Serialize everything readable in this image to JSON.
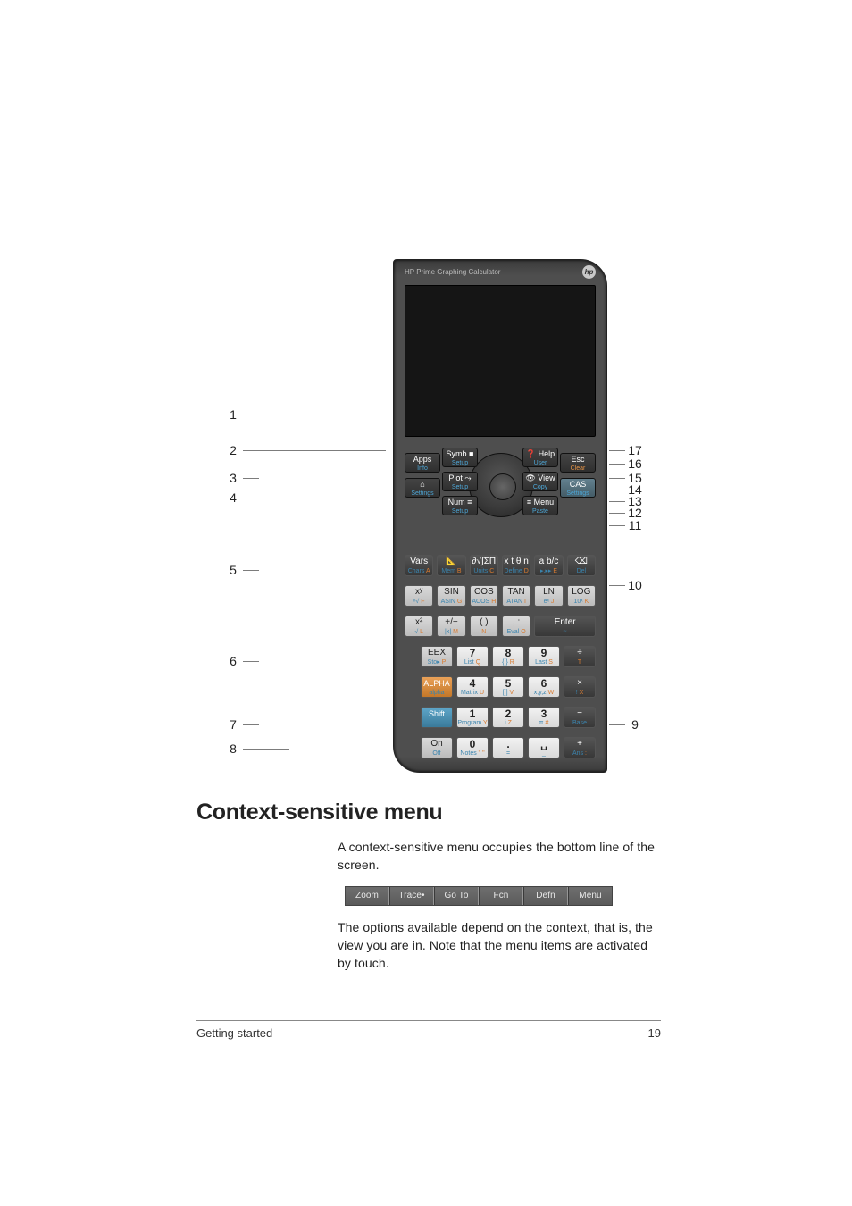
{
  "figure": {
    "brand": "HP Prime Graphing Calculator",
    "logo": "hp",
    "nav": {
      "apps": {
        "main": "Apps",
        "sub": "Info"
      },
      "symb": {
        "main": "Symb ■",
        "sub": "Setup"
      },
      "help": {
        "main": "❓ Help",
        "sub": "User"
      },
      "esc": {
        "main": "Esc",
        "sub": "Clear"
      },
      "home": {
        "main": "⌂",
        "sub": "Settings"
      },
      "plot": {
        "main": "Plot ⤳",
        "sub": "Setup"
      },
      "view": {
        "main": "👁 View",
        "sub": "Copy"
      },
      "cas": {
        "main": "CAS",
        "sub": "Settings"
      },
      "num": {
        "main": "Num ≡",
        "sub": "Setup"
      },
      "menu": {
        "main": "≡ Menu",
        "sub": "Paste"
      }
    },
    "rows": [
      [
        {
          "top": "Vars",
          "bot": "Chars",
          "br": "A",
          "cls": "dark"
        },
        {
          "top": "📐",
          "bot": "Mem",
          "br": "B",
          "cls": "dark"
        },
        {
          "top": "∂√∫ΣΠ",
          "bot": "Units",
          "br": "C",
          "cls": "dark"
        },
        {
          "top": "x t θ n",
          "bot": "Define",
          "br": "D",
          "cls": "dark"
        },
        {
          "top": "a b/c",
          "bot": "▸.▸▸",
          "br": "E",
          "cls": "dark"
        },
        {
          "top": "⌫",
          "bot": "Del",
          "br": "",
          "cls": "dark"
        }
      ],
      [
        {
          "top": "xʸ",
          "bot": "ⁿ√",
          "br": "F"
        },
        {
          "top": "SIN",
          "bot": "ASIN",
          "br": "G"
        },
        {
          "top": "COS",
          "bot": "ACOS",
          "br": "H"
        },
        {
          "top": "TAN",
          "bot": "ATAN",
          "br": "I"
        },
        {
          "top": "LN",
          "bot": "eˣ",
          "br": "J"
        },
        {
          "top": "LOG",
          "bot": "10ˣ",
          "br": "K"
        }
      ],
      [
        {
          "top": "x²",
          "bot": "√",
          "br": "L"
        },
        {
          "top": "+/−",
          "bot": "|x|",
          "br": "M"
        },
        {
          "top": "( )",
          "bot": "",
          "br": "N"
        },
        {
          "top": ", :",
          "bot": "Eval",
          "br": "O"
        },
        {
          "top": "Enter",
          "bot": "≈",
          "br": "",
          "cls": "dark enter"
        }
      ],
      [
        {
          "top": "EEX",
          "bot": "Sto▸",
          "br": "P"
        },
        {
          "top": "7",
          "bot": "List",
          "br": "Q",
          "cls": "num"
        },
        {
          "top": "8",
          "bot": "{ }",
          "br": "R",
          "cls": "num"
        },
        {
          "top": "9",
          "bot": "Last",
          "br": "S",
          "cls": "num"
        },
        {
          "top": "÷",
          "bot": "",
          "br": "T",
          "cls": "dark"
        }
      ],
      [
        {
          "top": "ALPHA",
          "bot": "alpha",
          "br": "",
          "cls": "alpha"
        },
        {
          "top": "4",
          "bot": "Matrix",
          "br": "U",
          "cls": "num"
        },
        {
          "top": "5",
          "bot": "[ ]",
          "br": "V",
          "cls": "num"
        },
        {
          "top": "6",
          "bot": "x,y,z",
          "br": "W",
          "cls": "num"
        },
        {
          "top": "×",
          "bot": "!",
          "br": "X",
          "cls": "dark"
        }
      ],
      [
        {
          "top": "Shift",
          "bot": "",
          "br": "",
          "cls": "shift"
        },
        {
          "top": "1",
          "bot": "Program",
          "br": "Y",
          "cls": "num"
        },
        {
          "top": "2",
          "bot": "i",
          "br": "Z",
          "cls": "num"
        },
        {
          "top": "3",
          "bot": "π",
          "br": "#",
          "cls": "num"
        },
        {
          "top": "−",
          "bot": "Base",
          "br": "",
          "cls": "dark"
        }
      ],
      [
        {
          "top": "On",
          "bot": "Off",
          "br": ""
        },
        {
          "top": "0",
          "bot": "Notes",
          "br": "\" \"",
          "cls": "num"
        },
        {
          "top": ".",
          "bot": "=",
          "br": "",
          "cls": "num"
        },
        {
          "top": "␣",
          "bot": "_",
          "br": "",
          "cls": "num"
        },
        {
          "top": "+",
          "bot": "Ans",
          "br": ":",
          "cls": "dark"
        }
      ]
    ],
    "callouts_left": {
      "1": "1",
      "2": "2",
      "3": "3",
      "4": "4",
      "5": "5",
      "6": "6",
      "7": "7",
      "8": "8"
    },
    "callouts_right": {
      "9": "9",
      "10": "10",
      "11": "11",
      "12": "12",
      "13": "13",
      "14": "14",
      "15": "15",
      "16": "16",
      "17": "17"
    }
  },
  "heading": "Context-sensitive menu",
  "para1": "A context-sensitive menu occupies the bottom line of the screen.",
  "para2": "The options available depend on the context, that is, the view you are in. Note that the menu items are activated by touch.",
  "menubar": [
    "Zoom",
    "Trace•",
    "Go To",
    "Fcn",
    "Defn",
    "Menu"
  ],
  "footer": {
    "section": "Getting started",
    "page": "19"
  }
}
